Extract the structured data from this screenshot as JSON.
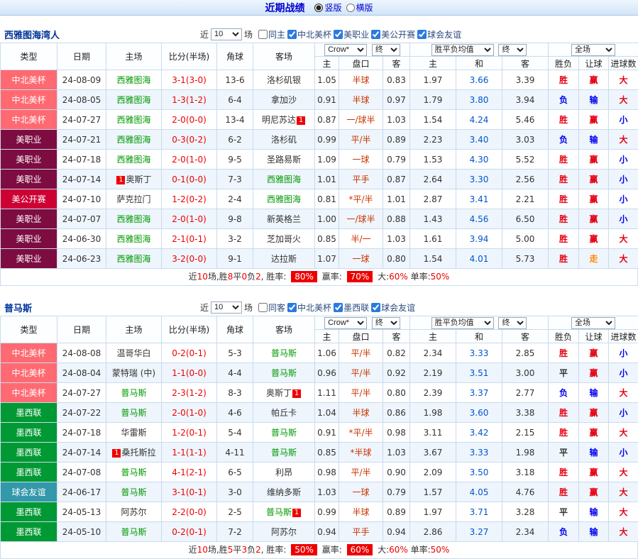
{
  "topbar": {
    "title": "近期战绩",
    "radios": [
      {
        "label": "竖版",
        "checked": true
      },
      {
        "label": "横版",
        "checked": false
      }
    ]
  },
  "filter_labels": {
    "near": "近",
    "games": "场"
  },
  "table_header": {
    "col_type": "类型",
    "col_date": "日期",
    "col_home": "主场",
    "col_score": "比分(半场)",
    "col_corner": "角球",
    "col_away": "客场",
    "odds_company": "Crow*",
    "odds_final": "终",
    "avg_label": "胜平负均值",
    "avg_final": "终",
    "fullmatch": "全场",
    "sub_home": "主",
    "sub_handicap": "盘口",
    "sub_away": "客",
    "sub_win": "主",
    "sub_draw": "和",
    "sub_lose": "客",
    "col_wdl": "胜负",
    "col_let": "让球",
    "col_goals": "进球数"
  },
  "colors": {
    "league": {
      "中北美杯": "#ff6a72",
      "美职业": "#7d0c41",
      "美公开赛": "#cc0033",
      "墨西联": "#009933",
      "球会友谊": "#3399aa"
    },
    "team_name": "#009900",
    "score": "#ee0000",
    "handicap": "#cc3300",
    "avg_draw": "#0055cc",
    "result": {
      "胜": "#e60012",
      "平": "#333333",
      "负": "#0000ee",
      "赢": "#e60012",
      "输": "#0000ee",
      "走": "#ff8800",
      "大": "#e60012",
      "小": "#0000ee"
    }
  },
  "sections": [
    {
      "team": "西雅图海湾人",
      "filter": {
        "count": "10",
        "checkboxes": [
          {
            "label": "同主",
            "checked": false
          },
          {
            "label": "中北美杯",
            "checked": true
          },
          {
            "label": "美职业",
            "checked": true
          },
          {
            "label": "美公开赛",
            "checked": true
          },
          {
            "label": "球会友谊",
            "checked": true
          }
        ]
      },
      "rows": [
        {
          "league": "中北美杯",
          "date": "24-08-09",
          "home": "西雅图海",
          "home_team": true,
          "score": "3-1(3-0)",
          "corners": "13-6",
          "away": "洛杉矶银",
          "o1": "1.05",
          "hc": "半球",
          "o2": "0.83",
          "a1": "1.97",
          "a2": "3.66",
          "a3": "3.39",
          "r1": "胜",
          "r2": "赢",
          "r3": "大"
        },
        {
          "league": "中北美杯",
          "date": "24-08-05",
          "home": "西雅图海",
          "home_team": true,
          "score": "1-3(1-2)",
          "corners": "6-4",
          "away": "拿加沙",
          "o1": "0.91",
          "hc": "半球",
          "o2": "0.97",
          "a1": "1.79",
          "a2": "3.80",
          "a3": "3.94",
          "r1": "负",
          "r2": "输",
          "r3": "大"
        },
        {
          "league": "中北美杯",
          "date": "24-07-27",
          "home": "西雅图海",
          "home_team": true,
          "score": "2-0(0-0)",
          "corners": "13-4",
          "away": "明尼苏达",
          "away_badge": "1",
          "away_badge_pos": "after",
          "o1": "0.87",
          "hc": "一/球半",
          "o2": "1.03",
          "a1": "1.54",
          "a2": "4.24",
          "a3": "5.46",
          "r1": "胜",
          "r2": "赢",
          "r3": "小"
        },
        {
          "league": "美职业",
          "date": "24-07-21",
          "home": "西雅图海",
          "home_team": true,
          "score": "0-3(0-2)",
          "corners": "6-2",
          "away": "洛杉矶",
          "o1": "0.99",
          "hc": "平/半",
          "o2": "0.89",
          "a1": "2.23",
          "a2": "3.40",
          "a3": "3.03",
          "r1": "负",
          "r2": "输",
          "r3": "大"
        },
        {
          "league": "美职业",
          "date": "24-07-18",
          "home": "西雅图海",
          "home_team": true,
          "score": "2-0(1-0)",
          "corners": "9-5",
          "away": "圣路易斯",
          "o1": "1.09",
          "hc": "一球",
          "o2": "0.79",
          "a1": "1.53",
          "a2": "4.30",
          "a3": "5.52",
          "r1": "胜",
          "r2": "赢",
          "r3": "小"
        },
        {
          "league": "美职业",
          "date": "24-07-14",
          "home": "奥斯丁",
          "home_badge": "1",
          "home_badge_pos": "before",
          "score": "0-1(0-0)",
          "corners": "7-3",
          "away": "西雅图海",
          "away_team": true,
          "o1": "1.01",
          "hc": "平手",
          "o2": "0.87",
          "a1": "2.64",
          "a2": "3.30",
          "a3": "2.56",
          "r1": "胜",
          "r2": "赢",
          "r3": "小"
        },
        {
          "league": "美公开赛",
          "date": "24-07-10",
          "home": "萨克拉门",
          "score": "1-2(0-2)",
          "corners": "2-4",
          "away": "西雅图海",
          "away_team": true,
          "o1": "0.81",
          "hc": "*平/半",
          "o2": "1.01",
          "a1": "2.87",
          "a2": "3.41",
          "a3": "2.21",
          "r1": "胜",
          "r2": "赢",
          "r3": "小"
        },
        {
          "league": "美职业",
          "date": "24-07-07",
          "home": "西雅图海",
          "home_team": true,
          "score": "2-0(1-0)",
          "corners": "9-8",
          "away": "新英格兰",
          "o1": "1.00",
          "hc": "一/球半",
          "o2": "0.88",
          "a1": "1.43",
          "a2": "4.56",
          "a3": "6.50",
          "r1": "胜",
          "r2": "赢",
          "r3": "小"
        },
        {
          "league": "美职业",
          "date": "24-06-30",
          "home": "西雅图海",
          "home_team": true,
          "score": "2-1(0-1)",
          "corners": "3-2",
          "away": "芝加哥火",
          "o1": "0.85",
          "hc": "半/一",
          "o2": "1.03",
          "a1": "1.61",
          "a2": "3.94",
          "a3": "5.00",
          "r1": "胜",
          "r2": "赢",
          "r3": "大"
        },
        {
          "league": "美职业",
          "date": "24-06-23",
          "home": "西雅图海",
          "home_team": true,
          "score": "3-2(0-0)",
          "corners": "9-1",
          "away": "达拉斯",
          "o1": "1.07",
          "hc": "一球",
          "o2": "0.80",
          "a1": "1.54",
          "a2": "4.01",
          "a3": "5.73",
          "r1": "胜",
          "r2": "走",
          "r3": "大"
        }
      ],
      "summary": [
        {
          "t": "近",
          "s": "plain"
        },
        {
          "t": "10",
          "s": "red"
        },
        {
          "t": "场,胜",
          "s": "plain"
        },
        {
          "t": "8",
          "s": "red"
        },
        {
          "t": "平",
          "s": "plain"
        },
        {
          "t": "0",
          "s": "red"
        },
        {
          "t": "负",
          "s": "plain"
        },
        {
          "t": "2",
          "s": "red"
        },
        {
          "t": ", 胜率: ",
          "s": "plain"
        },
        {
          "t": "80%",
          "s": "badge"
        },
        {
          "t": " 赢率: ",
          "s": "plain"
        },
        {
          "t": "70%",
          "s": "badge"
        },
        {
          "t": " 大:",
          "s": "plain"
        },
        {
          "t": "60%",
          "s": "red"
        },
        {
          "t": " 单率:",
          "s": "plain"
        },
        {
          "t": "50%",
          "s": "red"
        }
      ]
    },
    {
      "team": "普马斯",
      "filter": {
        "count": "10",
        "checkboxes": [
          {
            "label": "同客",
            "checked": false
          },
          {
            "label": "中北美杯",
            "checked": true
          },
          {
            "label": "墨西联",
            "checked": true
          },
          {
            "label": "球会友谊",
            "checked": true
          }
        ]
      },
      "rows": [
        {
          "league": "中北美杯",
          "date": "24-08-08",
          "home": "温哥华白",
          "score": "0-2(0-1)",
          "corners": "5-3",
          "away": "普马斯",
          "away_team": true,
          "o1": "1.06",
          "hc": "平/半",
          "o2": "0.82",
          "a1": "2.34",
          "a2": "3.33",
          "a3": "2.85",
          "r1": "胜",
          "r2": "赢",
          "r3": "小"
        },
        {
          "league": "中北美杯",
          "date": "24-08-04",
          "home": "蒙特瑞 (中)",
          "score": "1-1(0-0)",
          "corners": "4-4",
          "away": "普马斯",
          "away_team": true,
          "o1": "0.96",
          "hc": "平/半",
          "o2": "0.92",
          "a1": "2.19",
          "a2": "3.51",
          "a3": "3.00",
          "r1": "平",
          "r2": "赢",
          "r3": "小"
        },
        {
          "league": "中北美杯",
          "date": "24-07-27",
          "home": "普马斯",
          "home_team": true,
          "score": "2-3(1-2)",
          "corners": "8-3",
          "away": "奥斯丁",
          "away_badge": "1",
          "away_badge_pos": "after",
          "o1": "1.11",
          "hc": "平/半",
          "o2": "0.80",
          "a1": "2.39",
          "a2": "3.37",
          "a3": "2.77",
          "r1": "负",
          "r2": "输",
          "r3": "大"
        },
        {
          "league": "墨西联",
          "date": "24-07-22",
          "home": "普马斯",
          "home_team": true,
          "score": "2-0(1-0)",
          "corners": "4-6",
          "away": "帕丘卡",
          "o1": "1.04",
          "hc": "半球",
          "o2": "0.86",
          "a1": "1.98",
          "a2": "3.60",
          "a3": "3.38",
          "r1": "胜",
          "r2": "赢",
          "r3": "小"
        },
        {
          "league": "墨西联",
          "date": "24-07-18",
          "home": "华雷斯",
          "score": "1-2(0-1)",
          "corners": "5-4",
          "away": "普马斯",
          "away_team": true,
          "o1": "0.91",
          "hc": "*平/半",
          "o2": "0.98",
          "a1": "3.11",
          "a2": "3.42",
          "a3": "2.15",
          "r1": "胜",
          "r2": "赢",
          "r3": "大"
        },
        {
          "league": "墨西联",
          "date": "24-07-14",
          "home": "桑托斯拉",
          "home_badge": "1",
          "home_badge_pos": "before",
          "score": "1-1(1-1)",
          "corners": "4-11",
          "away": "普马斯",
          "away_team": true,
          "o1": "0.85",
          "hc": "*半球",
          "o2": "1.03",
          "a1": "3.67",
          "a2": "3.33",
          "a3": "1.98",
          "r1": "平",
          "r2": "输",
          "r3": "小"
        },
        {
          "league": "墨西联",
          "date": "24-07-08",
          "home": "普马斯",
          "home_team": true,
          "score": "4-1(2-1)",
          "corners": "6-5",
          "away": "利昂",
          "o1": "0.98",
          "hc": "平/半",
          "o2": "0.90",
          "a1": "2.09",
          "a2": "3.50",
          "a3": "3.18",
          "r1": "胜",
          "r2": "赢",
          "r3": "大"
        },
        {
          "league": "球会友谊",
          "date": "24-06-17",
          "home": "普马斯",
          "home_team": true,
          "score": "3-1(0-1)",
          "corners": "3-0",
          "away": "维纳多斯",
          "o1": "1.03",
          "hc": "一球",
          "o2": "0.79",
          "a1": "1.57",
          "a2": "4.05",
          "a3": "4.76",
          "r1": "胜",
          "r2": "赢",
          "r3": "大"
        },
        {
          "league": "墨西联",
          "date": "24-05-13",
          "home": "阿苏尔",
          "score": "2-2(0-0)",
          "corners": "2-5",
          "away": "普马斯",
          "away_team": true,
          "away_badge": "1",
          "away_badge_pos": "after",
          "o1": "0.99",
          "hc": "半球",
          "o2": "0.89",
          "a1": "1.97",
          "a2": "3.71",
          "a3": "3.28",
          "r1": "平",
          "r2": "输",
          "r3": "大"
        },
        {
          "league": "墨西联",
          "date": "24-05-10",
          "home": "普马斯",
          "home_team": true,
          "score": "0-2(0-1)",
          "corners": "7-2",
          "away": "阿苏尔",
          "o1": "0.94",
          "hc": "平手",
          "o2": "0.94",
          "a1": "2.86",
          "a2": "3.27",
          "a3": "2.34",
          "r1": "负",
          "r2": "输",
          "r3": "大"
        }
      ],
      "summary": [
        {
          "t": "近",
          "s": "plain"
        },
        {
          "t": "10",
          "s": "red"
        },
        {
          "t": "场,胜",
          "s": "plain"
        },
        {
          "t": "5",
          "s": "red"
        },
        {
          "t": "平",
          "s": "plain"
        },
        {
          "t": "3",
          "s": "red"
        },
        {
          "t": "负",
          "s": "plain"
        },
        {
          "t": "2",
          "s": "red"
        },
        {
          "t": ", 胜率: ",
          "s": "plain"
        },
        {
          "t": "50%",
          "s": "badge"
        },
        {
          "t": " 赢率: ",
          "s": "plain"
        },
        {
          "t": "60%",
          "s": "badge"
        },
        {
          "t": " 大:",
          "s": "plain"
        },
        {
          "t": "60%",
          "s": "red"
        },
        {
          "t": " 单率:",
          "s": "plain"
        },
        {
          "t": "50%",
          "s": "red"
        }
      ]
    }
  ]
}
